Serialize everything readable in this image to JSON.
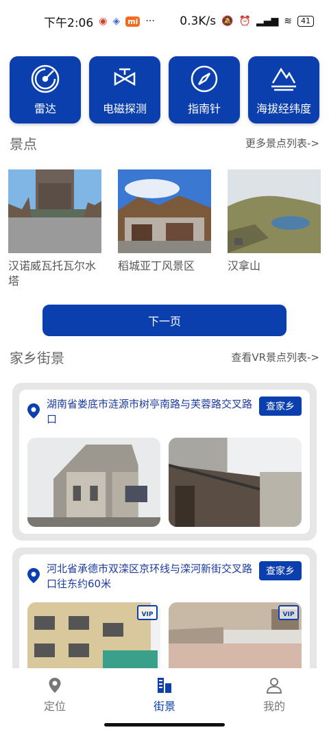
{
  "status_bar": {
    "time": "下午2:06",
    "speed": "0.3K/s",
    "battery": "41"
  },
  "tools": [
    {
      "label": "雷达",
      "icon": "radar-icon"
    },
    {
      "label": "电磁探测",
      "icon": "emf-detector-icon"
    },
    {
      "label": "指南针",
      "icon": "compass-icon"
    },
    {
      "label": "海拔经纬度",
      "icon": "altitude-icon"
    }
  ],
  "scenic": {
    "title": "景点",
    "more_link": "更多景点列表->",
    "items": [
      {
        "name": "汉诺威瓦托瓦尔水塔"
      },
      {
        "name": "稻城亚丁风景区"
      },
      {
        "name": "汉拿山"
      }
    ],
    "next_button": "下一页"
  },
  "street": {
    "title": "家乡街景",
    "vr_link": "查看VR景点列表->",
    "cards": [
      {
        "address": "湖南省娄底市涟源市树亭南路与芙蓉路交叉路口",
        "button": "查家乡",
        "vip": false
      },
      {
        "address": "河北省承德市双滦区京环线与滦河新街交叉路口往东约60米",
        "button": "查家乡",
        "vip": true
      }
    ]
  },
  "bottom_nav": [
    {
      "label": "定位",
      "icon": "location-pin-icon",
      "active": false
    },
    {
      "label": "街景",
      "icon": "buildings-icon",
      "active": true
    },
    {
      "label": "我的",
      "icon": "user-icon",
      "active": false
    }
  ],
  "colors": {
    "accent": "#0c3fae"
  }
}
